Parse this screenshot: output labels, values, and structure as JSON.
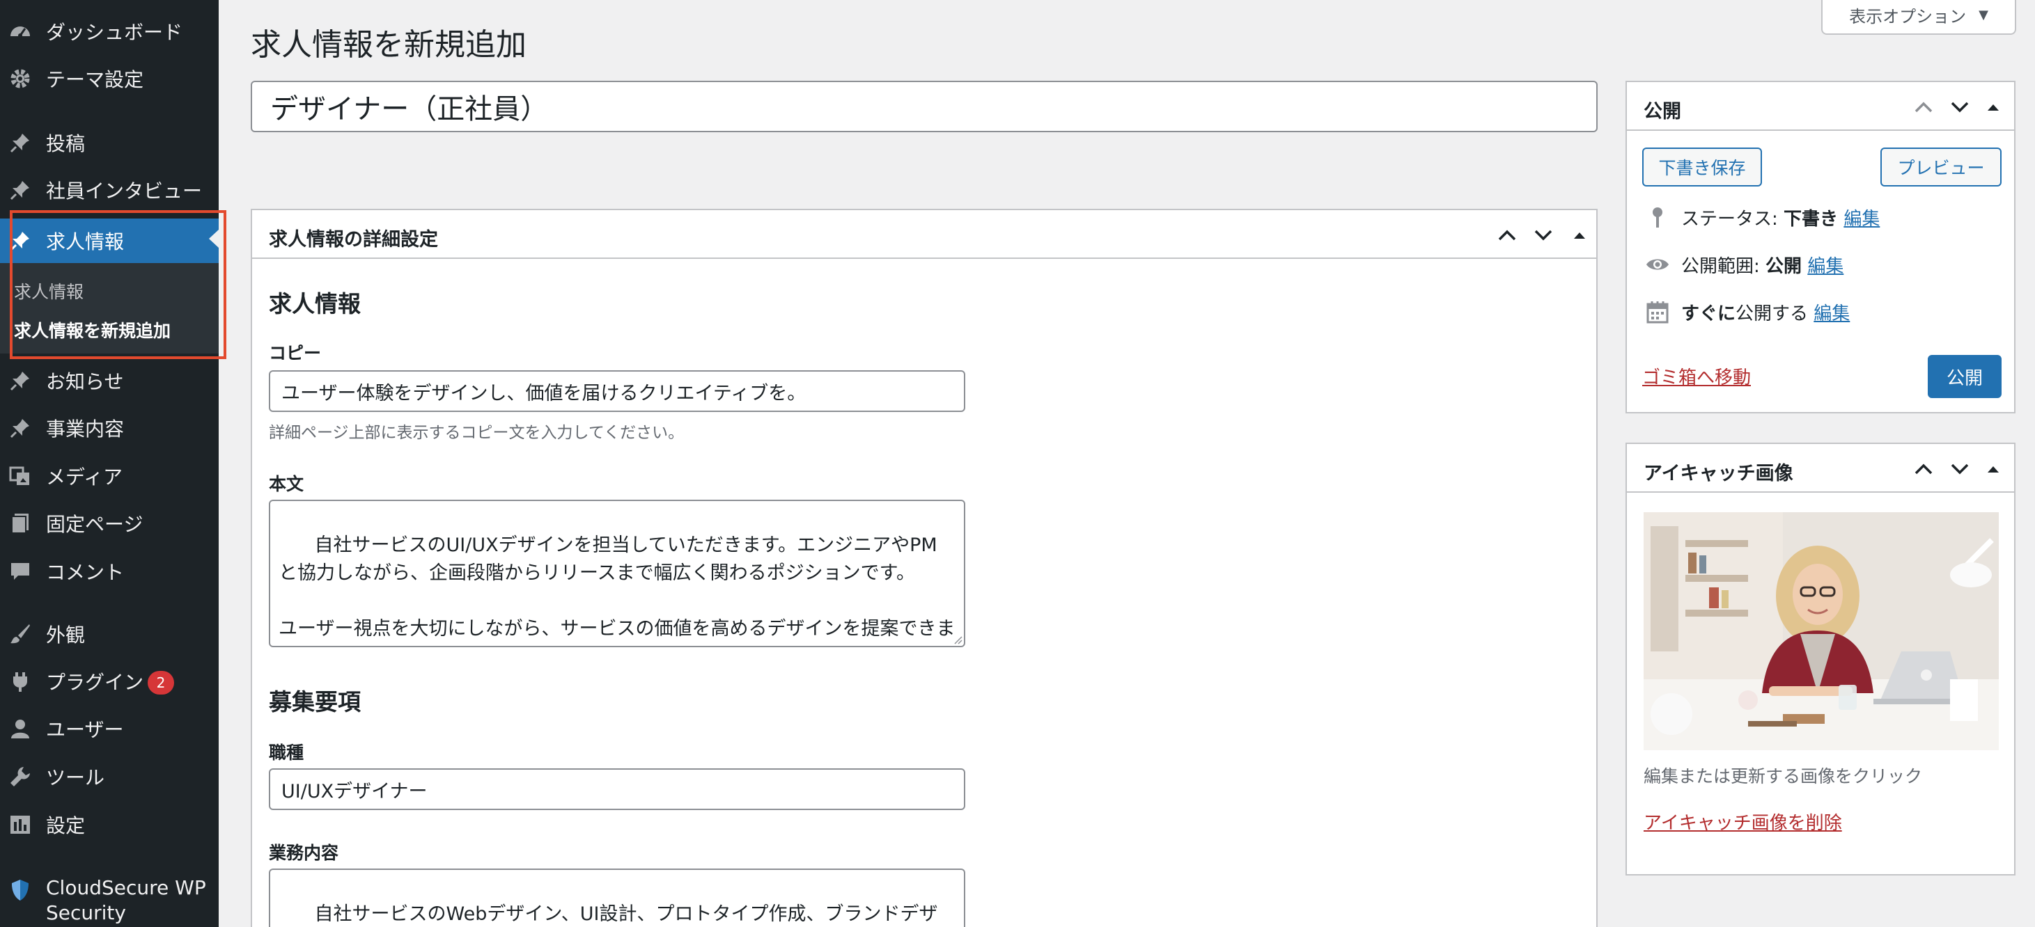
{
  "sidebar": {
    "items": [
      {
        "id": "dashboard",
        "label": "ダッシュボード",
        "icon": "gauge-icon"
      },
      {
        "id": "theme",
        "label": "テーマ設定",
        "icon": "gear-icon"
      },
      {
        "id": "posts",
        "label": "投稿",
        "icon": "pin-icon"
      },
      {
        "id": "interview",
        "label": "社員インタビュー",
        "icon": "pin-icon"
      },
      {
        "id": "jobs",
        "label": "求人情報",
        "icon": "pin-icon"
      },
      {
        "id": "news",
        "label": "お知らせ",
        "icon": "pin-icon"
      },
      {
        "id": "business",
        "label": "事業内容",
        "icon": "pin-icon"
      },
      {
        "id": "media",
        "label": "メディア",
        "icon": "media-icon"
      },
      {
        "id": "pages",
        "label": "固定ページ",
        "icon": "page-icon"
      },
      {
        "id": "comments",
        "label": "コメント",
        "icon": "comment-icon"
      },
      {
        "id": "appearance",
        "label": "外観",
        "icon": "brush-icon"
      },
      {
        "id": "plugins",
        "label": "プラグイン",
        "icon": "plugin-icon",
        "badge": "2"
      },
      {
        "id": "users",
        "label": "ユーザー",
        "icon": "user-icon"
      },
      {
        "id": "tools",
        "label": "ツール",
        "icon": "wrench-icon"
      },
      {
        "id": "settings",
        "label": "設定",
        "icon": "settings-icon"
      },
      {
        "id": "cloudsecure",
        "label": "CloudSecure WP Security",
        "label_line1": "CloudSecure WP",
        "label_line2": "Security",
        "icon": "shield-icon"
      }
    ],
    "submenu": [
      {
        "label": "求人情報"
      },
      {
        "label": "求人情報を新規追加"
      }
    ]
  },
  "header": {
    "page_title": "求人情報を新規追加",
    "screen_options": "表示オプション"
  },
  "post": {
    "title_value": "デザイナー（正社員）"
  },
  "details_box": {
    "title": "求人情報の詳細設定",
    "section1": "求人情報",
    "copy_label": "コピー",
    "copy_value": "ユーザー体験をデザインし、価値を届けるクリエイティブを。",
    "copy_help": "詳細ページ上部に表示するコピー文を入力してください。",
    "body_label": "本文",
    "body_value": "自社サービスのUI/UXデザインを担当していただきます。エンジニアやPMと協力しながら、企画段階からリリースまで幅広く関わるポジションです。\n\nユーザー視点を大切にしながら、サービスの価値を高めるデザインを提案できます。",
    "section2": "募集要項",
    "job_type_label": "職種",
    "job_type_value": "UI/UXデザイナー",
    "duties_label": "業務内容",
    "duties_value": "自社サービスのWebデザイン、UI設計、プロトタイプ作成、ブランドデザインなど"
  },
  "publish_box": {
    "title": "公開",
    "save_draft": "下書き保存",
    "preview": "プレビュー",
    "status_label": "ステータス:",
    "status_value": "下書き",
    "visibility_label": "公開範囲:",
    "visibility_value": "公開",
    "schedule_bold": "すぐに",
    "schedule_rest": "公開する",
    "edit": "編集",
    "trash": "ゴミ箱へ移動",
    "publish": "公開"
  },
  "featured_box": {
    "title": "アイキャッチ画像",
    "help": "編集または更新する画像をクリック",
    "remove": "アイキャッチ画像を削除"
  },
  "colors": {
    "sidebar_bg": "#1d2327",
    "accent": "#2271b1",
    "danger": "#b32d2e",
    "highlight": "#e34a2e"
  }
}
